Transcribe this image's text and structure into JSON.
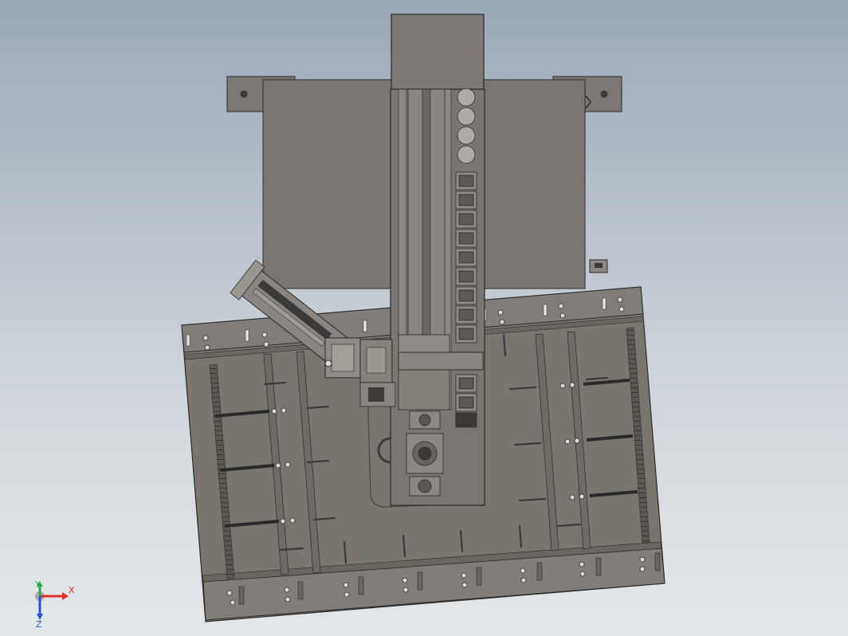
{
  "viewport": {
    "background_top": "#9aa7b5",
    "background_bottom": "#e4e7ea"
  },
  "colors": {
    "part_fill": "#7d7873",
    "part_fill_dark": "#6e6964",
    "part_fill_light": "#8c8782",
    "edge": "#2b2b2b",
    "slot": "#3a3a3a",
    "hole": "#d9d9d9"
  },
  "triad": {
    "x_label": "X",
    "y_label": "Y",
    "z_label": "Z",
    "x_color": "#e0312b",
    "y_color": "#2aa84a",
    "z_color": "#2b50d8"
  }
}
